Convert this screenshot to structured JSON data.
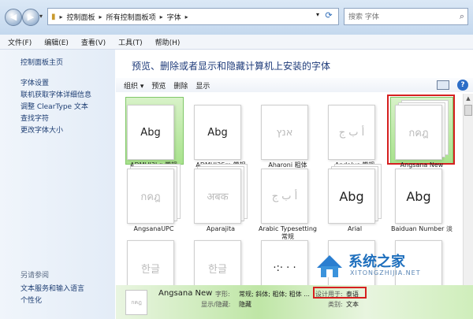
{
  "address": {
    "breadcrumbs": [
      "控制面板",
      "所有控制面板项",
      "字体"
    ],
    "search_placeholder": "搜索 字体"
  },
  "menu": [
    "文件(F)",
    "编辑(E)",
    "查看(V)",
    "工具(T)",
    "帮助(H)"
  ],
  "left_pane": {
    "home_link": "控制面板主页",
    "links": [
      "字体设置",
      "联机获取字体详细信息",
      "调整 ClearType 文本",
      "查找字符",
      "更改字体大小"
    ],
    "see_also_header": "另请参阅",
    "see_also_links": [
      "文本服务和输入语言",
      "个性化"
    ]
  },
  "content": {
    "heading": "预览、删除或者显示和隐藏计算机上安装的字体",
    "toolbar": [
      "组织 ▾",
      "预览",
      "删除",
      "显示"
    ]
  },
  "fonts": [
    {
      "name": "ADMUI3Lg 常规",
      "glyph": "Abg",
      "style": "plain",
      "selected": true
    },
    {
      "name": "ADMUI3Sm 常规",
      "glyph": "Abg",
      "style": "plain"
    },
    {
      "name": "Aharoni 粗体",
      "glyph": "אנץ",
      "style": "plain-faint"
    },
    {
      "name": "Andalus 常规",
      "glyph": "أ ب ج",
      "style": "plain-faint"
    },
    {
      "name": "Angsana New",
      "glyph": "กคฎ",
      "style": "stack-faint",
      "highlighted": true
    },
    {
      "name": "AngsanaUPC",
      "glyph": "กคฎ",
      "style": "stack-faint"
    },
    {
      "name": "Aparajita",
      "glyph": "अबक",
      "style": "stack-faint"
    },
    {
      "name": "Arabic Typesetting 常规",
      "glyph": "أ ب ج",
      "style": "plain-faint"
    },
    {
      "name": "Arial",
      "glyph": "Abg",
      "style": "stack-big"
    },
    {
      "name": "Baiduan Number 淡",
      "glyph": "Abg",
      "style": "plain-big"
    },
    {
      "name": "",
      "glyph": "한글",
      "style": "plain-faint"
    },
    {
      "name": "",
      "glyph": "한글",
      "style": "plain-faint"
    },
    {
      "name": "",
      "glyph": "·:· · ·",
      "style": "plain"
    },
    {
      "name": "",
      "glyph": "",
      "style": "plain"
    },
    {
      "name": "",
      "glyph": "",
      "style": "plain"
    }
  ],
  "details": {
    "icon_glyph": "กคฎ",
    "name": "Angsana New",
    "style_label": "字形:",
    "style_value": "常规; 斜体; 粗体; 粗体 ...",
    "state_label": "显示/隐藏:",
    "state_value": "隐藏",
    "designed_label": "设计用于:",
    "designed_value": "泰语",
    "category_label": "类别:",
    "category_value": "文本"
  },
  "watermark": {
    "text": "系统之家",
    "sub": "XITONGZHIJIA.NET"
  },
  "colors": {
    "selected_green": "#a8e28c",
    "highlight_red": "#d62020",
    "link_blue": "#1e3e73"
  }
}
